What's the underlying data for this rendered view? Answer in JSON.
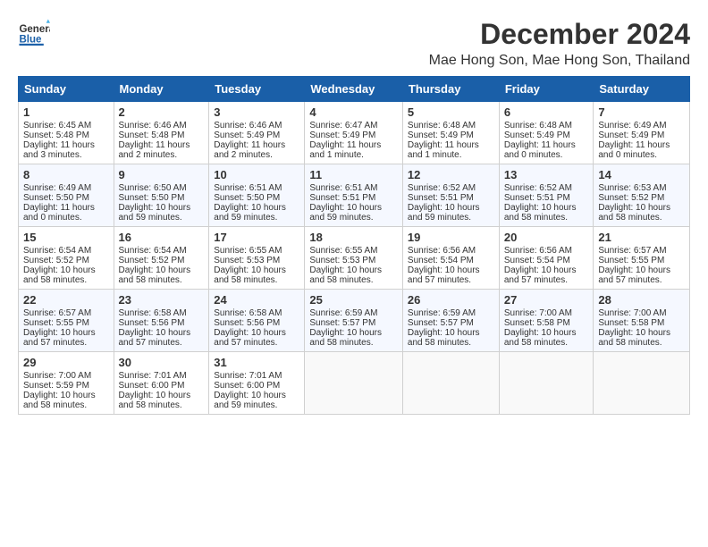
{
  "logo": {
    "line1": "General",
    "line2": "Blue"
  },
  "title": "December 2024",
  "location": "Mae Hong Son, Mae Hong Son, Thailand",
  "headers": [
    "Sunday",
    "Monday",
    "Tuesday",
    "Wednesday",
    "Thursday",
    "Friday",
    "Saturday"
  ],
  "weeks": [
    [
      {
        "day": "1",
        "sunrise": "Sunrise: 6:45 AM",
        "sunset": "Sunset: 5:48 PM",
        "daylight": "Daylight: 11 hours and 3 minutes."
      },
      {
        "day": "2",
        "sunrise": "Sunrise: 6:46 AM",
        "sunset": "Sunset: 5:48 PM",
        "daylight": "Daylight: 11 hours and 2 minutes."
      },
      {
        "day": "3",
        "sunrise": "Sunrise: 6:46 AM",
        "sunset": "Sunset: 5:49 PM",
        "daylight": "Daylight: 11 hours and 2 minutes."
      },
      {
        "day": "4",
        "sunrise": "Sunrise: 6:47 AM",
        "sunset": "Sunset: 5:49 PM",
        "daylight": "Daylight: 11 hours and 1 minute."
      },
      {
        "day": "5",
        "sunrise": "Sunrise: 6:48 AM",
        "sunset": "Sunset: 5:49 PM",
        "daylight": "Daylight: 11 hours and 1 minute."
      },
      {
        "day": "6",
        "sunrise": "Sunrise: 6:48 AM",
        "sunset": "Sunset: 5:49 PM",
        "daylight": "Daylight: 11 hours and 0 minutes."
      },
      {
        "day": "7",
        "sunrise": "Sunrise: 6:49 AM",
        "sunset": "Sunset: 5:49 PM",
        "daylight": "Daylight: 11 hours and 0 minutes."
      }
    ],
    [
      {
        "day": "8",
        "sunrise": "Sunrise: 6:49 AM",
        "sunset": "Sunset: 5:50 PM",
        "daylight": "Daylight: 11 hours and 0 minutes."
      },
      {
        "day": "9",
        "sunrise": "Sunrise: 6:50 AM",
        "sunset": "Sunset: 5:50 PM",
        "daylight": "Daylight: 10 hours and 59 minutes."
      },
      {
        "day": "10",
        "sunrise": "Sunrise: 6:51 AM",
        "sunset": "Sunset: 5:50 PM",
        "daylight": "Daylight: 10 hours and 59 minutes."
      },
      {
        "day": "11",
        "sunrise": "Sunrise: 6:51 AM",
        "sunset": "Sunset: 5:51 PM",
        "daylight": "Daylight: 10 hours and 59 minutes."
      },
      {
        "day": "12",
        "sunrise": "Sunrise: 6:52 AM",
        "sunset": "Sunset: 5:51 PM",
        "daylight": "Daylight: 10 hours and 59 minutes."
      },
      {
        "day": "13",
        "sunrise": "Sunrise: 6:52 AM",
        "sunset": "Sunset: 5:51 PM",
        "daylight": "Daylight: 10 hours and 58 minutes."
      },
      {
        "day": "14",
        "sunrise": "Sunrise: 6:53 AM",
        "sunset": "Sunset: 5:52 PM",
        "daylight": "Daylight: 10 hours and 58 minutes."
      }
    ],
    [
      {
        "day": "15",
        "sunrise": "Sunrise: 6:54 AM",
        "sunset": "Sunset: 5:52 PM",
        "daylight": "Daylight: 10 hours and 58 minutes."
      },
      {
        "day": "16",
        "sunrise": "Sunrise: 6:54 AM",
        "sunset": "Sunset: 5:52 PM",
        "daylight": "Daylight: 10 hours and 58 minutes."
      },
      {
        "day": "17",
        "sunrise": "Sunrise: 6:55 AM",
        "sunset": "Sunset: 5:53 PM",
        "daylight": "Daylight: 10 hours and 58 minutes."
      },
      {
        "day": "18",
        "sunrise": "Sunrise: 6:55 AM",
        "sunset": "Sunset: 5:53 PM",
        "daylight": "Daylight: 10 hours and 58 minutes."
      },
      {
        "day": "19",
        "sunrise": "Sunrise: 6:56 AM",
        "sunset": "Sunset: 5:54 PM",
        "daylight": "Daylight: 10 hours and 57 minutes."
      },
      {
        "day": "20",
        "sunrise": "Sunrise: 6:56 AM",
        "sunset": "Sunset: 5:54 PM",
        "daylight": "Daylight: 10 hours and 57 minutes."
      },
      {
        "day": "21",
        "sunrise": "Sunrise: 6:57 AM",
        "sunset": "Sunset: 5:55 PM",
        "daylight": "Daylight: 10 hours and 57 minutes."
      }
    ],
    [
      {
        "day": "22",
        "sunrise": "Sunrise: 6:57 AM",
        "sunset": "Sunset: 5:55 PM",
        "daylight": "Daylight: 10 hours and 57 minutes."
      },
      {
        "day": "23",
        "sunrise": "Sunrise: 6:58 AM",
        "sunset": "Sunset: 5:56 PM",
        "daylight": "Daylight: 10 hours and 57 minutes."
      },
      {
        "day": "24",
        "sunrise": "Sunrise: 6:58 AM",
        "sunset": "Sunset: 5:56 PM",
        "daylight": "Daylight: 10 hours and 57 minutes."
      },
      {
        "day": "25",
        "sunrise": "Sunrise: 6:59 AM",
        "sunset": "Sunset: 5:57 PM",
        "daylight": "Daylight: 10 hours and 58 minutes."
      },
      {
        "day": "26",
        "sunrise": "Sunrise: 6:59 AM",
        "sunset": "Sunset: 5:57 PM",
        "daylight": "Daylight: 10 hours and 58 minutes."
      },
      {
        "day": "27",
        "sunrise": "Sunrise: 7:00 AM",
        "sunset": "Sunset: 5:58 PM",
        "daylight": "Daylight: 10 hours and 58 minutes."
      },
      {
        "day": "28",
        "sunrise": "Sunrise: 7:00 AM",
        "sunset": "Sunset: 5:58 PM",
        "daylight": "Daylight: 10 hours and 58 minutes."
      }
    ],
    [
      {
        "day": "29",
        "sunrise": "Sunrise: 7:00 AM",
        "sunset": "Sunset: 5:59 PM",
        "daylight": "Daylight: 10 hours and 58 minutes."
      },
      {
        "day": "30",
        "sunrise": "Sunrise: 7:01 AM",
        "sunset": "Sunset: 6:00 PM",
        "daylight": "Daylight: 10 hours and 58 minutes."
      },
      {
        "day": "31",
        "sunrise": "Sunrise: 7:01 AM",
        "sunset": "Sunset: 6:00 PM",
        "daylight": "Daylight: 10 hours and 59 minutes."
      },
      null,
      null,
      null,
      null
    ]
  ]
}
